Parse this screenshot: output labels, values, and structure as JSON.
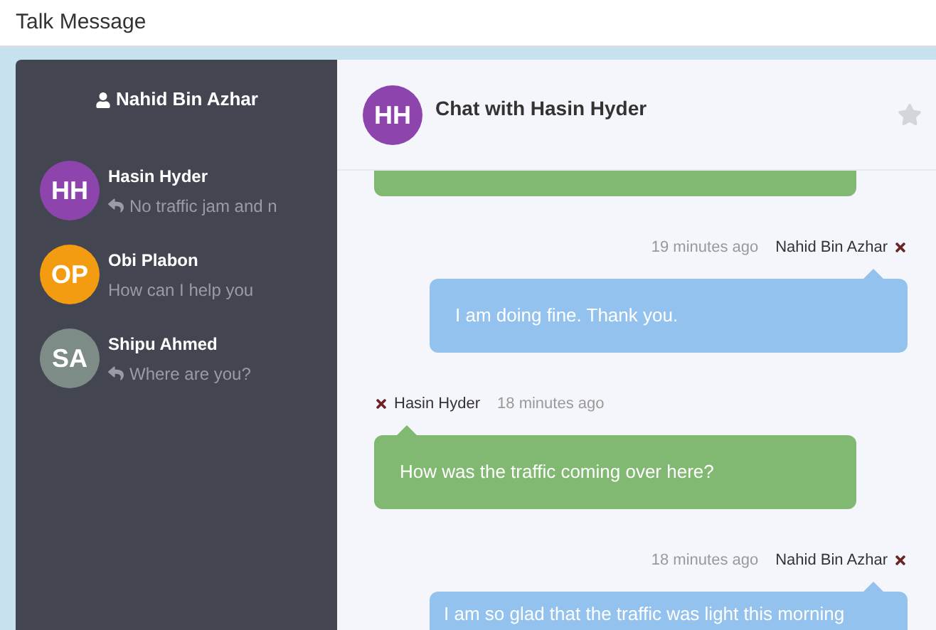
{
  "window": {
    "title": "Talk Message"
  },
  "sidebar": {
    "user": "Nahid Bin Azhar",
    "conversations": [
      {
        "initials": "HH",
        "color": "#8e44ad",
        "name": "Hasin Hyder",
        "preview": "No traffic jam and n",
        "replied": true
      },
      {
        "initials": "OP",
        "color": "#f39c12",
        "name": "Obi Plabon",
        "preview": "How can I help you",
        "replied": false
      },
      {
        "initials": "SA",
        "color": "#7e8c87",
        "name": "Shipu Ahmed",
        "preview": "Where are you?",
        "replied": true
      }
    ]
  },
  "chat": {
    "avatar": {
      "initials": "HH",
      "color": "#8e44ad"
    },
    "title": "Chat with Hasin Hyder",
    "starred": false,
    "messages": [
      {
        "kind": "incoming"
      },
      {
        "kind": "outgoing",
        "time": "19 minutes ago",
        "author": "Nahid Bin Azhar",
        "text": "I am doing fine. Thank you."
      },
      {
        "kind": "incoming",
        "time": "18 minutes ago",
        "author": "Hasin Hyder",
        "text": "How was the traffic coming over here?"
      },
      {
        "kind": "outgoing",
        "time": "18 minutes ago",
        "author": "Nahid Bin Azhar",
        "text": "I am so glad that the traffic was light this morning"
      }
    ]
  }
}
